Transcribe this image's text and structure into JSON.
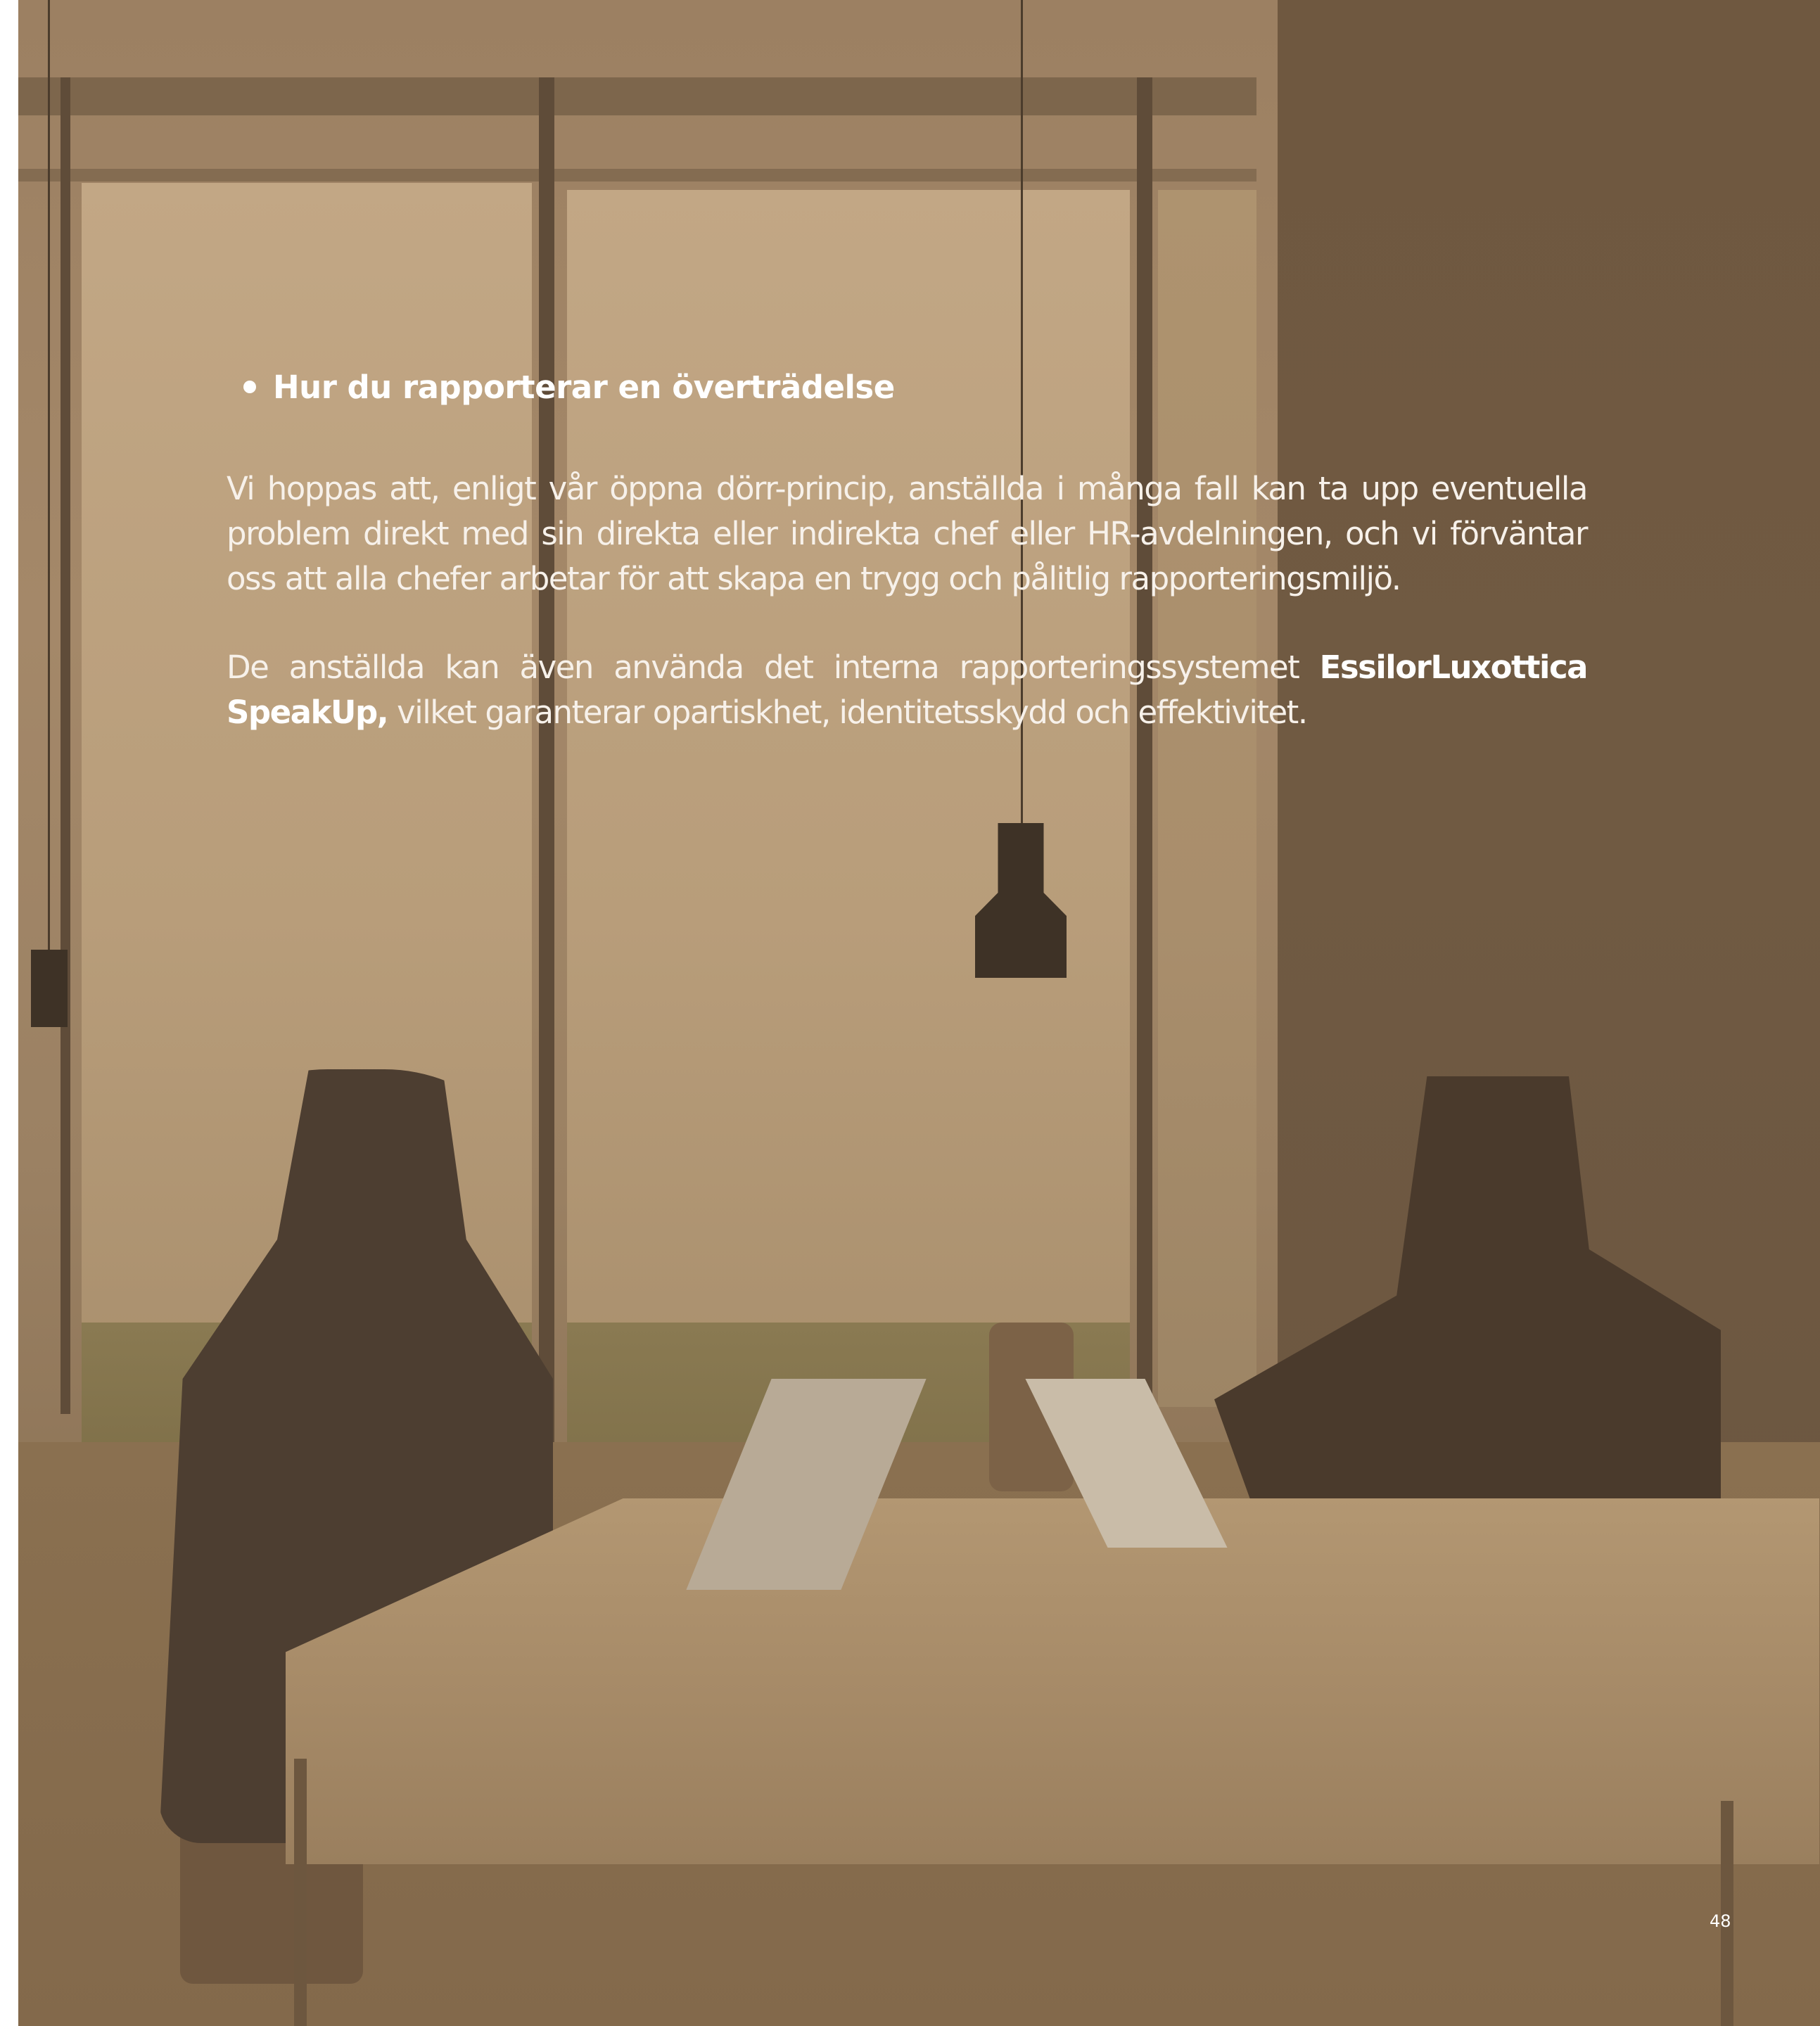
{
  "section": {
    "heading": "Hur du rapporterar en överträdelse",
    "paragraph_1": "Vi hoppas att, enligt vår öppna dörr-princip, anställda i många fall kan ta upp eventuella problem direkt med sin direkta eller indirekta chef eller HR-avdelningen, och vi förväntar oss att alla chefer arbetar för att skapa en trygg och pålitlig rapporteringsmiljö.",
    "paragraph_2": {
      "intro": "De anställda kan även använda det interna rapporteringssystemet ",
      "system_name": "EssilorLuxottica SpeakUp,",
      "outro": " vilket garanterar opartiskhet, identitetsskydd och effektivitet."
    }
  },
  "page_number": "48",
  "colors": {
    "background_tint": "#8a7050",
    "text": "#f7f1ea"
  },
  "background_photo": "two colleagues talking at a table with laptops in a bright office"
}
